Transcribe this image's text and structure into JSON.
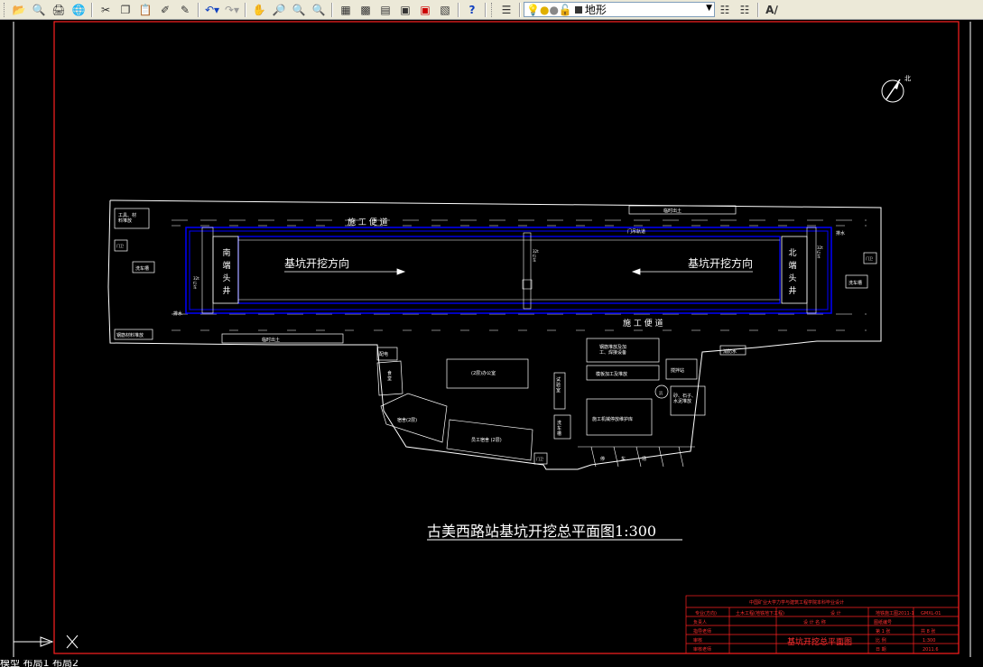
{
  "toolbar": {
    "icons": [
      "open-icon",
      "preview-icon",
      "print-icon",
      "publish-icon",
      "cut-icon",
      "copy-icon",
      "paste-icon",
      "matchprop-icon",
      "brush-icon",
      "undo-icon",
      "redo-icon",
      "pan-icon",
      "zoom-realtime-icon",
      "zoom-window-icon",
      "zoom-previous-icon",
      "properties-icon",
      "design-center-icon",
      "tool-palette-icon",
      "sheetset-icon",
      "markup-icon",
      "calculator-icon",
      "help-icon"
    ],
    "layer_name": "地形",
    "colors": {
      "bg": "#ece9d8",
      "bulb": "#f5e400",
      "sun": "#f0c020"
    }
  },
  "drawing": {
    "colors": {
      "background": "#000000",
      "border": "#ff0000",
      "lines": "#ffffff",
      "walls": "#0000ff"
    },
    "road_top": "施 工 便 道",
    "road_bottom": "施 工 便 道",
    "south_well": [
      "南",
      "端",
      "头",
      "井"
    ],
    "north_well": [
      "北",
      "端",
      "头",
      "井"
    ],
    "dig_left": "基坑开挖方向",
    "dig_right": "基坑开挖方向",
    "rig_left": "32t\n行\n车",
    "rig_right": "32t\n行\n车",
    "mid_rig": "32t\n行\n车",
    "car_gantry": "门吊轨道",
    "wash_left": "洗车槽",
    "wash_right": "洗车槽",
    "wash_bottom": "洗\n车\n槽",
    "gate_left": "门卫",
    "gate_right": "门卫",
    "gate_bottom": "门卫",
    "storage_top_left": "工具、材\n料堆放",
    "storage_bottom_left": "钢筋材料堆放",
    "spoil_left": "临时出土",
    "spoil_right": "临时出土",
    "drain_left": "排水",
    "drain_right": "排水",
    "office": "(2层)办公室",
    "dorm": "宿舍(2层)",
    "staff": "员工宿舍 (2层)",
    "canteen": "食\n堂",
    "power": "配电",
    "rebar": "钢筋堆放及加\n工、焊接设备",
    "form": "模板加工及堆放",
    "mixer": "搅拌站",
    "mixpit": "沉",
    "sand": "砂、石子、\n水泥堆放",
    "machine": "施工机械停放维护库",
    "hydrant": "消防水",
    "lab": "试\n验\n室",
    "parking": [
      "停",
      "车",
      "场"
    ],
    "title": "古美西路站基坑开挖总平面图1:300",
    "north_label": "北"
  },
  "titleblock": {
    "school": "中国矿业大学力学与建筑工程学院本科毕业设计",
    "major_label": "专业(方向)",
    "major": "土木工程(地铁地下工程)",
    "design_label": "设 计",
    "student_label": "姓名",
    "student": "",
    "drawing_no_label": "图纸编号",
    "drawing_no": "地铁施工图2011-1",
    "sheet_no_label": "图纸编号",
    "sheet_no": "GMXL-01",
    "leader_label": "负责人",
    "audit_label": "指导老师",
    "proj_label": "设 计 名 称",
    "school_label": "审核",
    "sheet_label": "第 1 张",
    "total_label": "共 8 张",
    "scale_label": "比 例",
    "scale": "1:300",
    "date_label": "日 期",
    "date": "2011.6",
    "drawing_title": "基坑开挖总平面图",
    "row5": "审核老师"
  },
  "status": {
    "text": "模型 布局1 布局2"
  }
}
